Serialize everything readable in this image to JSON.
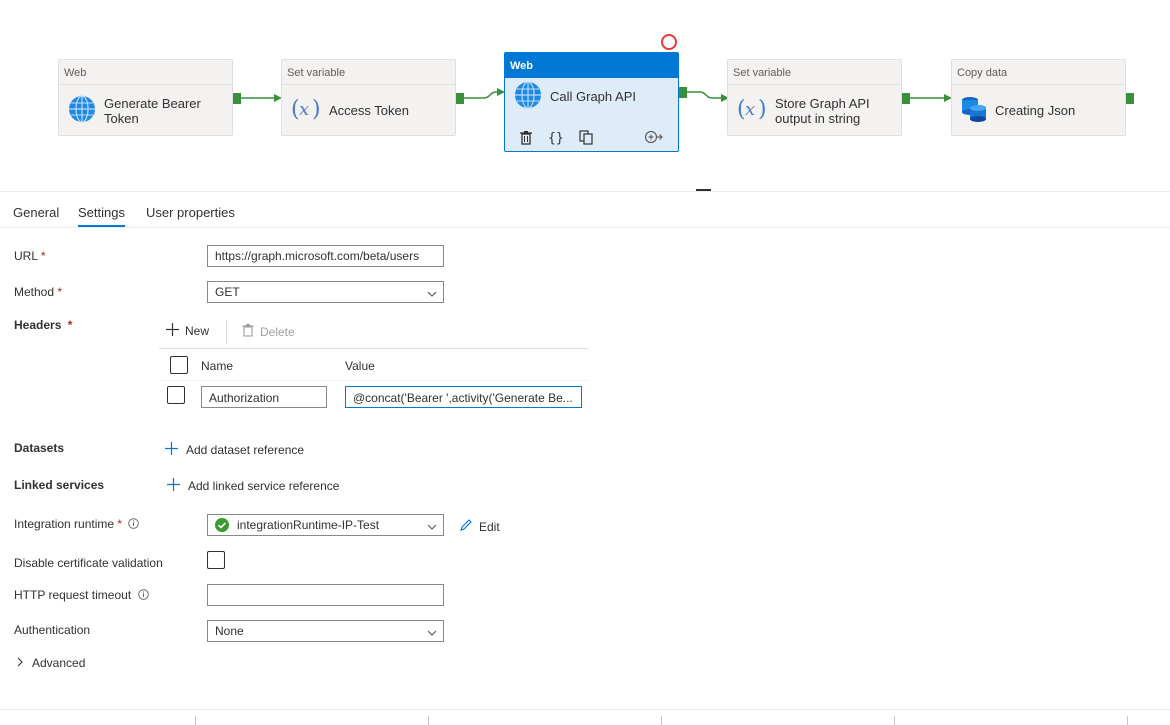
{
  "pipeline": {
    "activities": [
      {
        "type": "Web",
        "name": "Generate Bearer Token",
        "icon": "globe-icon"
      },
      {
        "type": "Set variable",
        "name": "Access Token",
        "icon": "variable-icon"
      },
      {
        "type": "Web",
        "name": "Call Graph API",
        "icon": "globe-icon",
        "selected": true
      },
      {
        "type": "Set variable",
        "name_line1": "Store Graph API",
        "name_line2": "output in string",
        "icon": "variable-icon"
      },
      {
        "type": "Copy data",
        "name": "Creating Json",
        "icon": "database-icon"
      }
    ],
    "colors": {
      "selected_accent": "#0078d4",
      "success_port": "#3a8f3a",
      "error_ring": "#e53935"
    }
  },
  "tabs": [
    {
      "label": "General"
    },
    {
      "label": "Settings",
      "active": true
    },
    {
      "label": "User properties"
    }
  ],
  "settings": {
    "url": {
      "label": "URL",
      "required": "*",
      "value": "https://graph.microsoft.com/beta/users"
    },
    "method": {
      "label": "Method",
      "required": "*",
      "value": "GET"
    },
    "headers": {
      "label": "Headers",
      "required": "*",
      "new_label": "New",
      "delete_label": "Delete",
      "col_name": "Name",
      "col_value": "Value",
      "rows": [
        {
          "name": "Authorization",
          "value": "@concat('Bearer ',activity('Generate Be..."
        }
      ]
    },
    "datasets": {
      "label": "Datasets",
      "action": "Add dataset reference"
    },
    "linked_services": {
      "label": "Linked services",
      "action": "Add linked service reference"
    },
    "integration_runtime": {
      "label": "Integration runtime",
      "required": "*",
      "value": "integrationRuntime-IP-Test",
      "edit_label": "Edit"
    },
    "disable_cert": {
      "label": "Disable certificate validation",
      "checked": false
    },
    "http_timeout": {
      "label": "HTTP request timeout",
      "value": ""
    },
    "authentication": {
      "label": "Authentication",
      "value": "None"
    },
    "advanced": {
      "label": "Advanced"
    }
  }
}
